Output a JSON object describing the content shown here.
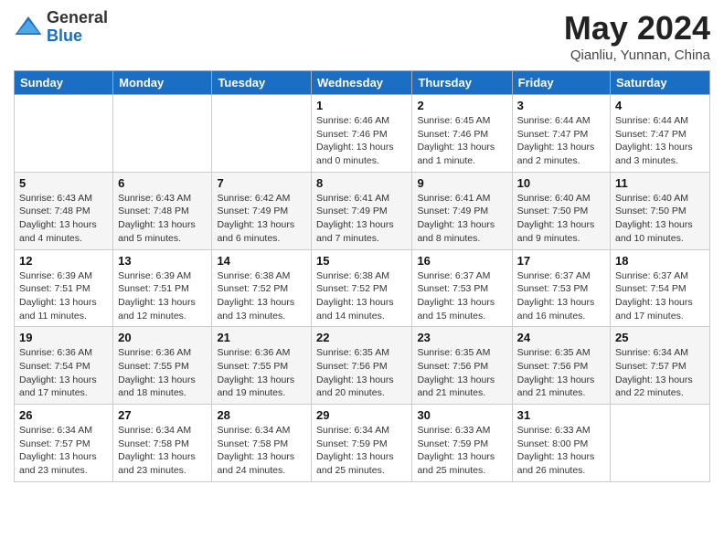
{
  "logo": {
    "general": "General",
    "blue": "Blue"
  },
  "title": "May 2024",
  "location": "Qianliu, Yunnan, China",
  "weekdays": [
    "Sunday",
    "Monday",
    "Tuesday",
    "Wednesday",
    "Thursday",
    "Friday",
    "Saturday"
  ],
  "weeks": [
    [
      {
        "day": "",
        "info": ""
      },
      {
        "day": "",
        "info": ""
      },
      {
        "day": "",
        "info": ""
      },
      {
        "day": "1",
        "info": "Sunrise: 6:46 AM\nSunset: 7:46 PM\nDaylight: 13 hours\nand 0 minutes."
      },
      {
        "day": "2",
        "info": "Sunrise: 6:45 AM\nSunset: 7:46 PM\nDaylight: 13 hours\nand 1 minute."
      },
      {
        "day": "3",
        "info": "Sunrise: 6:44 AM\nSunset: 7:47 PM\nDaylight: 13 hours\nand 2 minutes."
      },
      {
        "day": "4",
        "info": "Sunrise: 6:44 AM\nSunset: 7:47 PM\nDaylight: 13 hours\nand 3 minutes."
      }
    ],
    [
      {
        "day": "5",
        "info": "Sunrise: 6:43 AM\nSunset: 7:48 PM\nDaylight: 13 hours\nand 4 minutes."
      },
      {
        "day": "6",
        "info": "Sunrise: 6:43 AM\nSunset: 7:48 PM\nDaylight: 13 hours\nand 5 minutes."
      },
      {
        "day": "7",
        "info": "Sunrise: 6:42 AM\nSunset: 7:49 PM\nDaylight: 13 hours\nand 6 minutes."
      },
      {
        "day": "8",
        "info": "Sunrise: 6:41 AM\nSunset: 7:49 PM\nDaylight: 13 hours\nand 7 minutes."
      },
      {
        "day": "9",
        "info": "Sunrise: 6:41 AM\nSunset: 7:49 PM\nDaylight: 13 hours\nand 8 minutes."
      },
      {
        "day": "10",
        "info": "Sunrise: 6:40 AM\nSunset: 7:50 PM\nDaylight: 13 hours\nand 9 minutes."
      },
      {
        "day": "11",
        "info": "Sunrise: 6:40 AM\nSunset: 7:50 PM\nDaylight: 13 hours\nand 10 minutes."
      }
    ],
    [
      {
        "day": "12",
        "info": "Sunrise: 6:39 AM\nSunset: 7:51 PM\nDaylight: 13 hours\nand 11 minutes."
      },
      {
        "day": "13",
        "info": "Sunrise: 6:39 AM\nSunset: 7:51 PM\nDaylight: 13 hours\nand 12 minutes."
      },
      {
        "day": "14",
        "info": "Sunrise: 6:38 AM\nSunset: 7:52 PM\nDaylight: 13 hours\nand 13 minutes."
      },
      {
        "day": "15",
        "info": "Sunrise: 6:38 AM\nSunset: 7:52 PM\nDaylight: 13 hours\nand 14 minutes."
      },
      {
        "day": "16",
        "info": "Sunrise: 6:37 AM\nSunset: 7:53 PM\nDaylight: 13 hours\nand 15 minutes."
      },
      {
        "day": "17",
        "info": "Sunrise: 6:37 AM\nSunset: 7:53 PM\nDaylight: 13 hours\nand 16 minutes."
      },
      {
        "day": "18",
        "info": "Sunrise: 6:37 AM\nSunset: 7:54 PM\nDaylight: 13 hours\nand 17 minutes."
      }
    ],
    [
      {
        "day": "19",
        "info": "Sunrise: 6:36 AM\nSunset: 7:54 PM\nDaylight: 13 hours\nand 17 minutes."
      },
      {
        "day": "20",
        "info": "Sunrise: 6:36 AM\nSunset: 7:55 PM\nDaylight: 13 hours\nand 18 minutes."
      },
      {
        "day": "21",
        "info": "Sunrise: 6:36 AM\nSunset: 7:55 PM\nDaylight: 13 hours\nand 19 minutes."
      },
      {
        "day": "22",
        "info": "Sunrise: 6:35 AM\nSunset: 7:56 PM\nDaylight: 13 hours\nand 20 minutes."
      },
      {
        "day": "23",
        "info": "Sunrise: 6:35 AM\nSunset: 7:56 PM\nDaylight: 13 hours\nand 21 minutes."
      },
      {
        "day": "24",
        "info": "Sunrise: 6:35 AM\nSunset: 7:56 PM\nDaylight: 13 hours\nand 21 minutes."
      },
      {
        "day": "25",
        "info": "Sunrise: 6:34 AM\nSunset: 7:57 PM\nDaylight: 13 hours\nand 22 minutes."
      }
    ],
    [
      {
        "day": "26",
        "info": "Sunrise: 6:34 AM\nSunset: 7:57 PM\nDaylight: 13 hours\nand 23 minutes."
      },
      {
        "day": "27",
        "info": "Sunrise: 6:34 AM\nSunset: 7:58 PM\nDaylight: 13 hours\nand 23 minutes."
      },
      {
        "day": "28",
        "info": "Sunrise: 6:34 AM\nSunset: 7:58 PM\nDaylight: 13 hours\nand 24 minutes."
      },
      {
        "day": "29",
        "info": "Sunrise: 6:34 AM\nSunset: 7:59 PM\nDaylight: 13 hours\nand 25 minutes."
      },
      {
        "day": "30",
        "info": "Sunrise: 6:33 AM\nSunset: 7:59 PM\nDaylight: 13 hours\nand 25 minutes."
      },
      {
        "day": "31",
        "info": "Sunrise: 6:33 AM\nSunset: 8:00 PM\nDaylight: 13 hours\nand 26 minutes."
      },
      {
        "day": "",
        "info": ""
      }
    ]
  ]
}
